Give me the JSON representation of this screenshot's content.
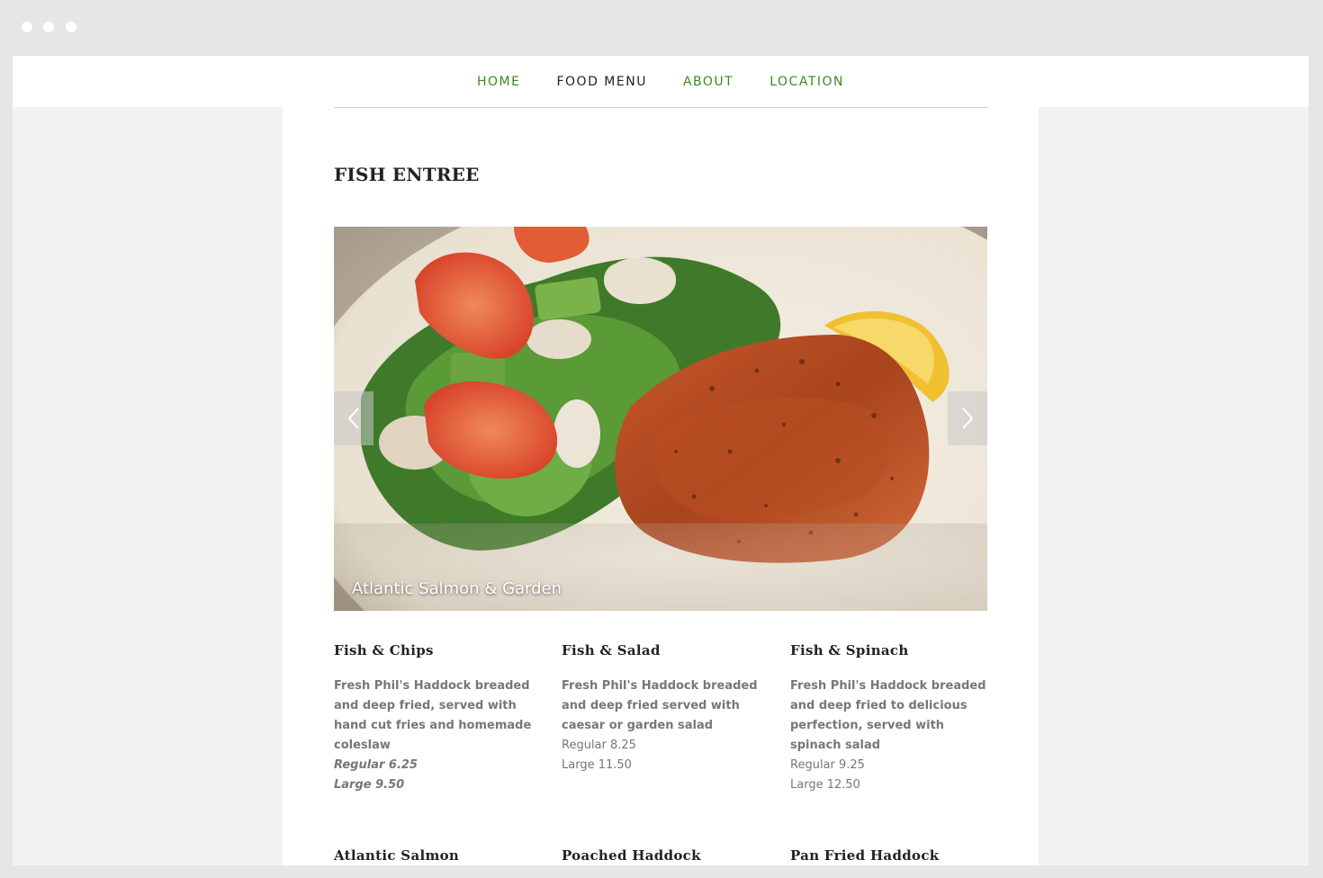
{
  "nav": {
    "items": [
      {
        "label": "HOME",
        "active": false
      },
      {
        "label": "FOOD MENU",
        "active": true
      },
      {
        "label": "ABOUT",
        "active": false
      },
      {
        "label": "LOCATION",
        "active": false
      }
    ]
  },
  "page": {
    "title": "FISH ENTREE"
  },
  "slider": {
    "caption": "Atlantic Salmon & Garden"
  },
  "menu": [
    {
      "name": "Fish & Chips",
      "description": "Fresh Phil's Haddock breaded and deep fried, served with hand cut fries and homemade coleslaw",
      "price_regular": "Regular 6.25",
      "price_large": "Large 9.50"
    },
    {
      "name": "Fish & Salad",
      "description": "Fresh Phil's Haddock breaded and deep fried served with caesar or garden salad",
      "price_regular": "Regular 8.25",
      "price_large": "Large 11.50"
    },
    {
      "name": "Fish & Spinach",
      "description": "Fresh Phil's Haddock breaded and deep fried to delicious perfection, served with spinach salad",
      "price_regular": "Regular 9.25",
      "price_large": "Large 12.50"
    },
    {
      "name": "Atlantic Salmon"
    },
    {
      "name": "Poached Haddock"
    },
    {
      "name": "Pan Fried Haddock"
    }
  ],
  "colors": {
    "accent": "#3a8a1f",
    "text_dark": "#222222",
    "text_muted": "#777777"
  }
}
